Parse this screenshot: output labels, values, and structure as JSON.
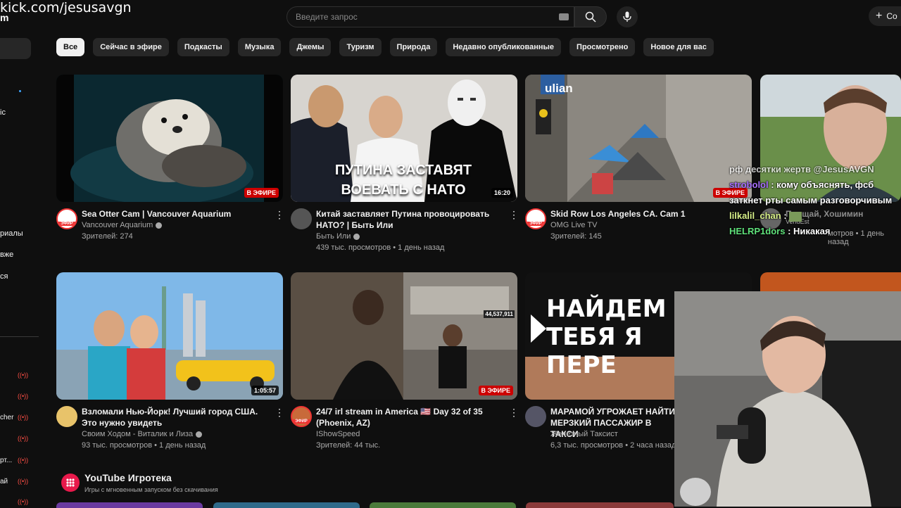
{
  "overlay": {
    "url": "kick.com/jesusavgn",
    "corner_char": "m"
  },
  "sidebar": {
    "items": [
      {
        "label": "ic",
        "top": 0
      },
      {
        "label": "риалы"
      },
      {
        "label": "вже"
      },
      {
        "label": "ся"
      }
    ],
    "live_items": [
      {
        "label": ""
      },
      {
        "label": ""
      },
      {
        "label": "cher"
      },
      {
        "label": ""
      },
      {
        "label": "рт..."
      },
      {
        "label": "ай"
      },
      {
        "label": ""
      }
    ]
  },
  "header": {
    "search_placeholder": "Введите запрос",
    "create_label": "Со"
  },
  "chips": [
    "Все",
    "Сейчас в эфире",
    "Подкасты",
    "Музыка",
    "Джемы",
    "Туризм",
    "Природа",
    "Недавно опубликованные",
    "Просмотрено",
    "Новое для вас"
  ],
  "videos": [
    {
      "title": "Sea Otter Cam | Vancouver Aquarium",
      "channel": "Vancouver Aquarium",
      "stats": "Зрителей: 274",
      "badge": "В ЭФИРЕ",
      "badge_type": "live",
      "avatar_label": "ЭФИР",
      "thumb_text": ""
    },
    {
      "title": "Китай заставляет Путина провоцировать НАТО? | Быть Или",
      "channel": "Быть Или",
      "stats": "439 тыс. просмотров • 1 день назад",
      "badge": "16:20",
      "badge_type": "dur",
      "thumb_text": "ПУТИНА ЗАСТАВЯТ ВОЕВАТЬ С НАТО"
    },
    {
      "title": "Skid Row Los Angeles CA. Cam 1",
      "channel": "OMG Live TV",
      "stats": "Зрителей: 145",
      "badge": "В ЭФИРЕ",
      "badge_type": "live",
      "avatar_label": "ЭФИР",
      "thumb_text": "ulian"
    },
    {
      "title": "",
      "channel": "VendEst",
      "stats": "мотров • 1 день назад",
      "badge": "",
      "thumb_text": ""
    },
    {
      "title": "Взломали Нью-Йорк! Лучший город США. Это нужно увидеть",
      "channel": "Своим Ходом - Виталик и Лиза",
      "stats": "93 тыс. просмотров • 1 день назад",
      "badge": "1:05:57",
      "badge_type": "dur"
    },
    {
      "title": "24/7 irl stream in America 🇺🇸 Day 32 of 35 (Phoenix, AZ)",
      "channel": "IShowSpeed",
      "stats": "Зрителей: 44 тыс.",
      "badge": "В ЭФИРЕ",
      "badge_type": "live",
      "avatar_label": "ЭФИР",
      "thumb_text": "44,537,911"
    },
    {
      "title": "МАРАМОЙ УГРОЖАЕТ НАЙТИ МЕРЗКИЙ ПАССАЖИР В ТАКСИ",
      "channel": "Железный Таксист",
      "stats": "6,3 тыс. просмотров • 2 часа назад",
      "thumb_text": "НАЙДЕМ ТЕБЯ Я ПЕРЕ"
    }
  ],
  "partial_card": {
    "title": "Прощай, Хошимин"
  },
  "section": {
    "title": "YouTube Игротека",
    "subtitle": "Игры с мгновенным запуском без скачивания"
  },
  "chat": [
    {
      "user": "",
      "text": "рф десятки жертв @JesusAVGN",
      "color": "#ffffff"
    },
    {
      "user": "strobolol",
      "text": ": кому объяснять, фсб заткнет рты самым разговорчивым",
      "color": "#a970ff"
    },
    {
      "user": "lilkalil_chan",
      "text": ":",
      "color": "#d8f08a"
    },
    {
      "user": "HELRP1dors",
      "text": ": Никакая",
      "color": "#5fe07a"
    }
  ],
  "colors": {
    "bg": "#0f0f0f",
    "live": "#cc0000",
    "chip": "#272727"
  }
}
